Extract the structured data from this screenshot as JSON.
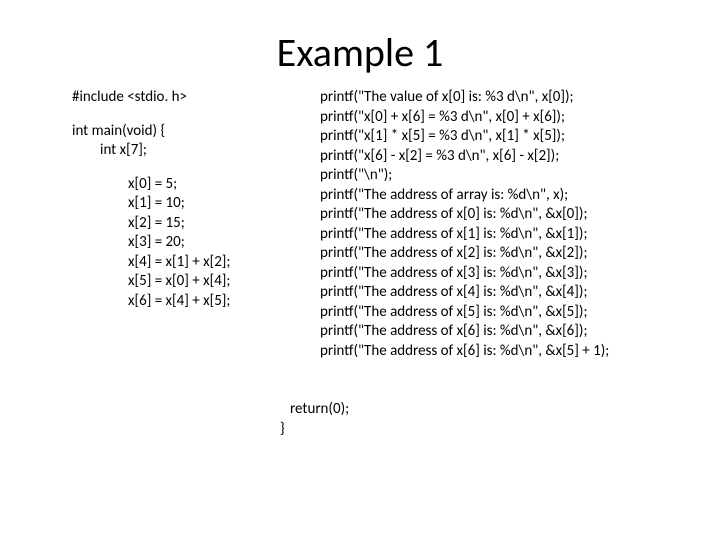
{
  "title": "Example 1",
  "left": {
    "l1": "#include <stdio. h>",
    "l2": "int main(void) {",
    "l3": "int x[7];",
    "l4": "x[0] = 5;",
    "l5": "x[1] = 10;",
    "l6": "x[2] = 15;",
    "l7": "x[3] = 20;",
    "l8": "x[4] = x[1] + x[2];",
    "l9": "x[5] = x[0] + x[4];",
    "l10": "x[6] = x[4] + x[5];"
  },
  "right": {
    "r1": "printf(\"The value of x[0] is: %3 d\\n\", x[0]);",
    "r2": "printf(\"x[0] + x[6] = %3 d\\n\", x[0] + x[6]);",
    "r3": "printf(\"x[1] * x[5] = %3 d\\n\", x[1] * x[5]);",
    "r4": "printf(\"x[6] - x[2] = %3 d\\n\", x[6] - x[2]);",
    "r5": "printf(\"\\n\");",
    "r6": "printf(\"The address of array is: %d\\n\", x);",
    "r7": "printf(\"The address of x[0] is: %d\\n\", &x[0]);",
    "r8": "printf(\"The address of x[1] is: %d\\n\", &x[1]);",
    "r9": "printf(\"The address of x[2] is: %d\\n\", &x[2]);",
    "r10": "printf(\"The address of x[3] is: %d\\n\", &x[3]);",
    "r11": "printf(\"The address of x[4] is: %d\\n\", &x[4]);",
    "r12": "printf(\"The address of x[5] is: %d\\n\", &x[5]);",
    "r13": "printf(\"The address of x[6] is: %d\\n\", &x[6]);",
    "r14": "printf(\"The address of x[6] is: %d\\n\", &x[5] + 1);"
  },
  "ret": "return(0);",
  "brace": "}"
}
